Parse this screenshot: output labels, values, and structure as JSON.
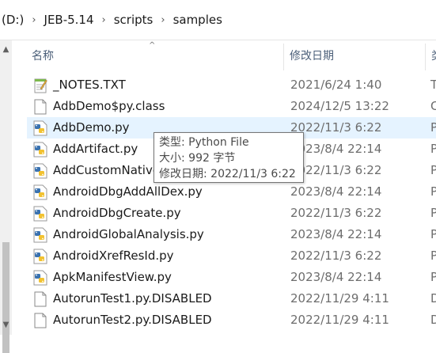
{
  "breadcrumb": {
    "items": [
      "(D:)",
      "JEB-5.14",
      "scripts",
      "samples"
    ],
    "separator": "›"
  },
  "columns": {
    "name": "名称",
    "date_modified": "修改日期",
    "type": "类"
  },
  "files": [
    {
      "name": "_NOTES.TXT",
      "date": "2021/6/24 1:40",
      "type": "T",
      "icon": "text-file-icon"
    },
    {
      "name": "AdbDemo$py.class",
      "date": "2024/12/5 13:22",
      "type": "C",
      "icon": "blank-file-icon"
    },
    {
      "name": "AdbDemo.py",
      "date": "2022/11/3 6:22",
      "type": "P",
      "icon": "python-file-icon"
    },
    {
      "name": "AddArtifact.py",
      "date": "2023/8/4 22:14",
      "type": "P",
      "icon": "python-file-icon"
    },
    {
      "name": "AddCustomNative",
      "date": "2022/11/3 6:22",
      "type": "P",
      "icon": "python-file-icon"
    },
    {
      "name": "AndroidDbgAddAllDex.py",
      "date": "2023/8/4 22:14",
      "type": "P",
      "icon": "python-file-icon"
    },
    {
      "name": "AndroidDbgCreate.py",
      "date": "2022/11/3 6:22",
      "type": "P",
      "icon": "python-file-icon"
    },
    {
      "name": "AndroidGlobalAnalysis.py",
      "date": "2023/8/4 22:14",
      "type": "P",
      "icon": "python-file-icon"
    },
    {
      "name": "AndroidXrefResId.py",
      "date": "2022/11/3 6:22",
      "type": "P",
      "icon": "python-file-icon"
    },
    {
      "name": "ApkManifestView.py",
      "date": "2023/8/4 22:14",
      "type": "P",
      "icon": "python-file-icon"
    },
    {
      "name": "AutorunTest1.py.DISABLED",
      "date": "2022/11/29 4:11",
      "type": "D",
      "icon": "blank-file-icon"
    },
    {
      "name": "AutorunTest2.py.DISABLED",
      "date": "2022/11/29 4:11",
      "type": "D",
      "icon": "blank-file-icon"
    }
  ],
  "selected_index": 2,
  "tooltip": {
    "type_label": "类型:",
    "type_value": " Python File",
    "size_label": "大小:",
    "size_value": " 992 字节",
    "modified_label": "修改日期:",
    "modified_value": " 2022/11/3 6:22"
  },
  "colors": {
    "selection": "#e5f3ff",
    "header_text": "#4c607a",
    "date_text": "#6d6d6d"
  }
}
